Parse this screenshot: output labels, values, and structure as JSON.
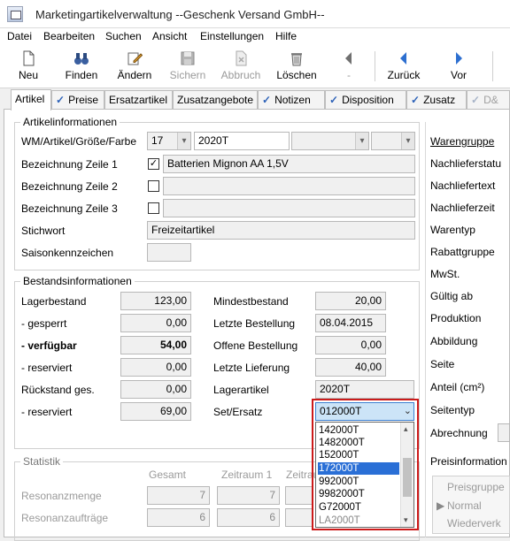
{
  "window": {
    "title": "Marketingartikelverwaltung --Geschenk Versand GmbH--"
  },
  "menu": [
    "Datei",
    "Bearbeiten",
    "Suchen",
    "Ansicht",
    "Einstellungen",
    "Hilfe"
  ],
  "toolbar": {
    "neu": "Neu",
    "finden": "Finden",
    "aendern": "Ändern",
    "sichern": "Sichern",
    "abbruch": "Abbruch",
    "loeschen": "Löschen",
    "dash": "-",
    "zurueck": "Zurück",
    "vor": "Vor"
  },
  "tabs": [
    "Artikel",
    "Preise",
    "Ersatzartikel",
    "Zusatzangebote",
    "Notizen",
    "Disposition",
    "Zusatz",
    "D&"
  ],
  "artikel": {
    "group_title": "Artikelinformationen",
    "wm_label": "WM/Artikel/Größe/Farbe",
    "wm_value": "17",
    "artikel_value": "2020T",
    "bez1_label": "Bezeichnung Zeile 1",
    "bez1_value": "Batterien Mignon AA 1,5V",
    "bez2_label": "Bezeichnung Zeile 2",
    "bez3_label": "Bezeichnung Zeile 3",
    "stichwort_label": "Stichwort",
    "stichwort_value": "Freizeitartikel",
    "saison_label": "Saisonkennzeichen",
    "check_mark": "✓"
  },
  "bestand": {
    "group_title": "Bestandsinformationen",
    "lagerbestand_label": "Lagerbestand",
    "lagerbestand": "123,00",
    "gesperrt_label": "- gesperrt",
    "gesperrt": "0,00",
    "verfuegbar_label": "- verfügbar",
    "verfuegbar": "54,00",
    "reserviert_label": "- reserviert",
    "reserviert": "0,00",
    "rueckstand_label": "Rückstand ges.",
    "rueckstand": "0,00",
    "reserviert2_label": "- reserviert",
    "reserviert2": "69,00",
    "mindest_label": "Mindestbestand",
    "mindest": "20,00",
    "letzte_best_label": "Letzte Bestellung",
    "letzte_best": "08.04.2015",
    "offene_label": "Offene Bestellung",
    "offene": "0,00",
    "letzte_lief_label": "Letzte Lieferung",
    "letzte_lief": "40,00",
    "lagerartikel_label": "Lagerartikel",
    "lagerartikel": "2020T",
    "set_label": "Set/Ersatz",
    "set_value": "012000T"
  },
  "dropdown": [
    "142000T",
    "1482000T",
    "152000T",
    "172000T",
    "992000T",
    "9982000T",
    "G72000T",
    "LA2000T"
  ],
  "statistik": {
    "group_title": "Statistik",
    "gesamt": "Gesamt",
    "zeitraum1": "Zeitraum 1",
    "zeitraum2": "Zeitrau",
    "menge_label": "Resonanzmenge",
    "menge_gesamt": "7",
    "menge_z1": "7",
    "auftraege_label": "Resonanzaufträge",
    "auftraege_gesamt": "6",
    "auftraege_z1": "6"
  },
  "right_panel": {
    "warengruppe": "Warengruppe",
    "nachlieferstatus": "Nachlieferstatu",
    "nachliefertext": "Nachliefertext",
    "nachlieferzeit": "Nachlieferzeit",
    "warentyp": "Warentyp",
    "rabattgruppe": "Rabattgruppe",
    "mwst": "MwSt.",
    "gueltig": "Gültig ab",
    "produktion": "Produktion",
    "abbildung": "Abbildung",
    "seite": "Seite",
    "anteil": "Anteil (cm²)",
    "seitentyp": "Seitentyp",
    "abrechnung": "Abrechnung",
    "preisinfo": "Preisinformation",
    "preisgruppe": "Preisgruppe",
    "normal": "Normal",
    "wiederverk": "Wiederverk"
  }
}
